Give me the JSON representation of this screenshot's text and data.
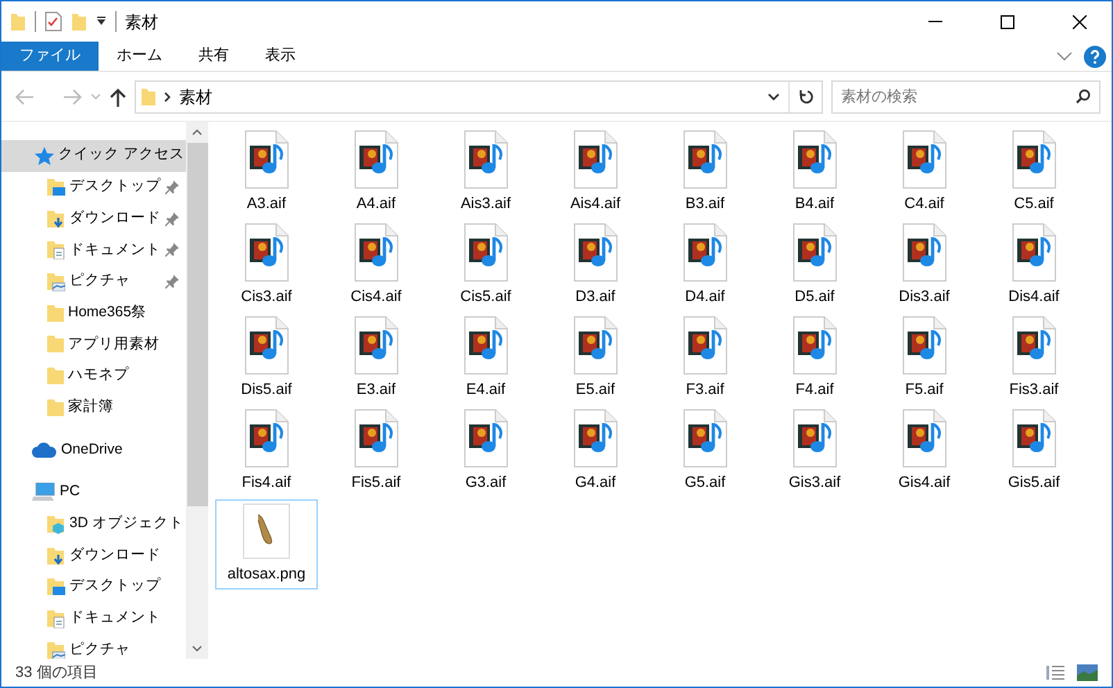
{
  "window": {
    "title": "素材"
  },
  "ribbon_tabs": [
    {
      "label": "ファイル",
      "selected": true
    },
    {
      "label": "ホーム",
      "selected": false
    },
    {
      "label": "共有",
      "selected": false
    },
    {
      "label": "表示",
      "selected": false
    }
  ],
  "address": {
    "path": [
      "素材"
    ]
  },
  "search": {
    "placeholder": "素材の検索"
  },
  "sidebar": {
    "items": [
      {
        "label": "クイック アクセス",
        "kind": "star",
        "selected": true,
        "children": [
          {
            "label": "デスクトップ",
            "kind": "desktop",
            "pinned": true
          },
          {
            "label": "ダウンロード",
            "kind": "download",
            "pinned": true
          },
          {
            "label": "ドキュメント",
            "kind": "documents",
            "pinned": true
          },
          {
            "label": "ピクチャ",
            "kind": "pictures",
            "pinned": true
          },
          {
            "label": "Home365祭",
            "kind": "folder",
            "pinned": false
          },
          {
            "label": "アプリ用素材",
            "kind": "folder",
            "pinned": false
          },
          {
            "label": "ハモネプ",
            "kind": "folder",
            "pinned": false
          },
          {
            "label": "家計簿",
            "kind": "folder",
            "pinned": false
          }
        ]
      },
      {
        "label": "OneDrive",
        "kind": "cloud",
        "selected": false
      },
      {
        "label": "PC",
        "kind": "pc",
        "selected": false,
        "children": [
          {
            "label": "3D オブジェクト",
            "kind": "objects3d",
            "pinned": false
          },
          {
            "label": "ダウンロード",
            "kind": "download",
            "pinned": false
          },
          {
            "label": "デスクトップ",
            "kind": "desktop",
            "pinned": false
          },
          {
            "label": "ドキュメント",
            "kind": "documents",
            "pinned": false
          },
          {
            "label": "ピクチャ",
            "kind": "pictures",
            "pinned": false
          }
        ]
      }
    ]
  },
  "files": [
    {
      "name": "A3.aif",
      "kind": "audio",
      "focused": false
    },
    {
      "name": "A4.aif",
      "kind": "audio",
      "focused": false
    },
    {
      "name": "Ais3.aif",
      "kind": "audio",
      "focused": false
    },
    {
      "name": "Ais4.aif",
      "kind": "audio",
      "focused": false
    },
    {
      "name": "B3.aif",
      "kind": "audio",
      "focused": false
    },
    {
      "name": "B4.aif",
      "kind": "audio",
      "focused": false
    },
    {
      "name": "C4.aif",
      "kind": "audio",
      "focused": false
    },
    {
      "name": "C5.aif",
      "kind": "audio",
      "focused": false
    },
    {
      "name": "Cis3.aif",
      "kind": "audio",
      "focused": false
    },
    {
      "name": "Cis4.aif",
      "kind": "audio",
      "focused": false
    },
    {
      "name": "Cis5.aif",
      "kind": "audio",
      "focused": false
    },
    {
      "name": "D3.aif",
      "kind": "audio",
      "focused": false
    },
    {
      "name": "D4.aif",
      "kind": "audio",
      "focused": false
    },
    {
      "name": "D5.aif",
      "kind": "audio",
      "focused": false
    },
    {
      "name": "Dis3.aif",
      "kind": "audio",
      "focused": false
    },
    {
      "name": "Dis4.aif",
      "kind": "audio",
      "focused": false
    },
    {
      "name": "Dis5.aif",
      "kind": "audio",
      "focused": false
    },
    {
      "name": "E3.aif",
      "kind": "audio",
      "focused": false
    },
    {
      "name": "E4.aif",
      "kind": "audio",
      "focused": false
    },
    {
      "name": "E5.aif",
      "kind": "audio",
      "focused": false
    },
    {
      "name": "F3.aif",
      "kind": "audio",
      "focused": false
    },
    {
      "name": "F4.aif",
      "kind": "audio",
      "focused": false
    },
    {
      "name": "F5.aif",
      "kind": "audio",
      "focused": false
    },
    {
      "name": "Fis3.aif",
      "kind": "audio",
      "focused": false
    },
    {
      "name": "Fis4.aif",
      "kind": "audio",
      "focused": false
    },
    {
      "name": "Fis5.aif",
      "kind": "audio",
      "focused": false
    },
    {
      "name": "G3.aif",
      "kind": "audio",
      "focused": false
    },
    {
      "name": "G4.aif",
      "kind": "audio",
      "focused": false
    },
    {
      "name": "G5.aif",
      "kind": "audio",
      "focused": false
    },
    {
      "name": "Gis3.aif",
      "kind": "audio",
      "focused": false
    },
    {
      "name": "Gis4.aif",
      "kind": "audio",
      "focused": false
    },
    {
      "name": "Gis5.aif",
      "kind": "audio",
      "focused": false
    },
    {
      "name": "altosax.png",
      "kind": "image",
      "focused": true
    }
  ],
  "status_bar": {
    "item_count": "33 個の項目"
  }
}
